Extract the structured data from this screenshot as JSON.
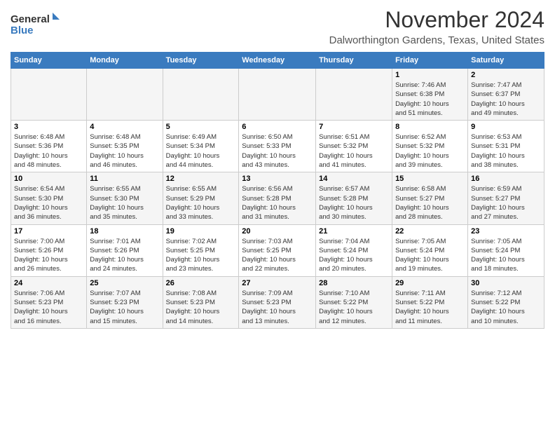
{
  "header": {
    "logo_line1": "General",
    "logo_line2": "Blue",
    "month": "November 2024",
    "location": "Dalworthington Gardens, Texas, United States"
  },
  "days_of_week": [
    "Sunday",
    "Monday",
    "Tuesday",
    "Wednesday",
    "Thursday",
    "Friday",
    "Saturday"
  ],
  "weeks": [
    [
      {
        "day": "",
        "info": ""
      },
      {
        "day": "",
        "info": ""
      },
      {
        "day": "",
        "info": ""
      },
      {
        "day": "",
        "info": ""
      },
      {
        "day": "",
        "info": ""
      },
      {
        "day": "1",
        "info": "Sunrise: 7:46 AM\nSunset: 6:38 PM\nDaylight: 10 hours\nand 51 minutes."
      },
      {
        "day": "2",
        "info": "Sunrise: 7:47 AM\nSunset: 6:37 PM\nDaylight: 10 hours\nand 49 minutes."
      }
    ],
    [
      {
        "day": "3",
        "info": "Sunrise: 6:48 AM\nSunset: 5:36 PM\nDaylight: 10 hours\nand 48 minutes."
      },
      {
        "day": "4",
        "info": "Sunrise: 6:48 AM\nSunset: 5:35 PM\nDaylight: 10 hours\nand 46 minutes."
      },
      {
        "day": "5",
        "info": "Sunrise: 6:49 AM\nSunset: 5:34 PM\nDaylight: 10 hours\nand 44 minutes."
      },
      {
        "day": "6",
        "info": "Sunrise: 6:50 AM\nSunset: 5:33 PM\nDaylight: 10 hours\nand 43 minutes."
      },
      {
        "day": "7",
        "info": "Sunrise: 6:51 AM\nSunset: 5:32 PM\nDaylight: 10 hours\nand 41 minutes."
      },
      {
        "day": "8",
        "info": "Sunrise: 6:52 AM\nSunset: 5:32 PM\nDaylight: 10 hours\nand 39 minutes."
      },
      {
        "day": "9",
        "info": "Sunrise: 6:53 AM\nSunset: 5:31 PM\nDaylight: 10 hours\nand 38 minutes."
      }
    ],
    [
      {
        "day": "10",
        "info": "Sunrise: 6:54 AM\nSunset: 5:30 PM\nDaylight: 10 hours\nand 36 minutes."
      },
      {
        "day": "11",
        "info": "Sunrise: 6:55 AM\nSunset: 5:30 PM\nDaylight: 10 hours\nand 35 minutes."
      },
      {
        "day": "12",
        "info": "Sunrise: 6:55 AM\nSunset: 5:29 PM\nDaylight: 10 hours\nand 33 minutes."
      },
      {
        "day": "13",
        "info": "Sunrise: 6:56 AM\nSunset: 5:28 PM\nDaylight: 10 hours\nand 31 minutes."
      },
      {
        "day": "14",
        "info": "Sunrise: 6:57 AM\nSunset: 5:28 PM\nDaylight: 10 hours\nand 30 minutes."
      },
      {
        "day": "15",
        "info": "Sunrise: 6:58 AM\nSunset: 5:27 PM\nDaylight: 10 hours\nand 28 minutes."
      },
      {
        "day": "16",
        "info": "Sunrise: 6:59 AM\nSunset: 5:27 PM\nDaylight: 10 hours\nand 27 minutes."
      }
    ],
    [
      {
        "day": "17",
        "info": "Sunrise: 7:00 AM\nSunset: 5:26 PM\nDaylight: 10 hours\nand 26 minutes."
      },
      {
        "day": "18",
        "info": "Sunrise: 7:01 AM\nSunset: 5:26 PM\nDaylight: 10 hours\nand 24 minutes."
      },
      {
        "day": "19",
        "info": "Sunrise: 7:02 AM\nSunset: 5:25 PM\nDaylight: 10 hours\nand 23 minutes."
      },
      {
        "day": "20",
        "info": "Sunrise: 7:03 AM\nSunset: 5:25 PM\nDaylight: 10 hours\nand 22 minutes."
      },
      {
        "day": "21",
        "info": "Sunrise: 7:04 AM\nSunset: 5:24 PM\nDaylight: 10 hours\nand 20 minutes."
      },
      {
        "day": "22",
        "info": "Sunrise: 7:05 AM\nSunset: 5:24 PM\nDaylight: 10 hours\nand 19 minutes."
      },
      {
        "day": "23",
        "info": "Sunrise: 7:05 AM\nSunset: 5:24 PM\nDaylight: 10 hours\nand 18 minutes."
      }
    ],
    [
      {
        "day": "24",
        "info": "Sunrise: 7:06 AM\nSunset: 5:23 PM\nDaylight: 10 hours\nand 16 minutes."
      },
      {
        "day": "25",
        "info": "Sunrise: 7:07 AM\nSunset: 5:23 PM\nDaylight: 10 hours\nand 15 minutes."
      },
      {
        "day": "26",
        "info": "Sunrise: 7:08 AM\nSunset: 5:23 PM\nDaylight: 10 hours\nand 14 minutes."
      },
      {
        "day": "27",
        "info": "Sunrise: 7:09 AM\nSunset: 5:23 PM\nDaylight: 10 hours\nand 13 minutes."
      },
      {
        "day": "28",
        "info": "Sunrise: 7:10 AM\nSunset: 5:22 PM\nDaylight: 10 hours\nand 12 minutes."
      },
      {
        "day": "29",
        "info": "Sunrise: 7:11 AM\nSunset: 5:22 PM\nDaylight: 10 hours\nand 11 minutes."
      },
      {
        "day": "30",
        "info": "Sunrise: 7:12 AM\nSunset: 5:22 PM\nDaylight: 10 hours\nand 10 minutes."
      }
    ]
  ]
}
